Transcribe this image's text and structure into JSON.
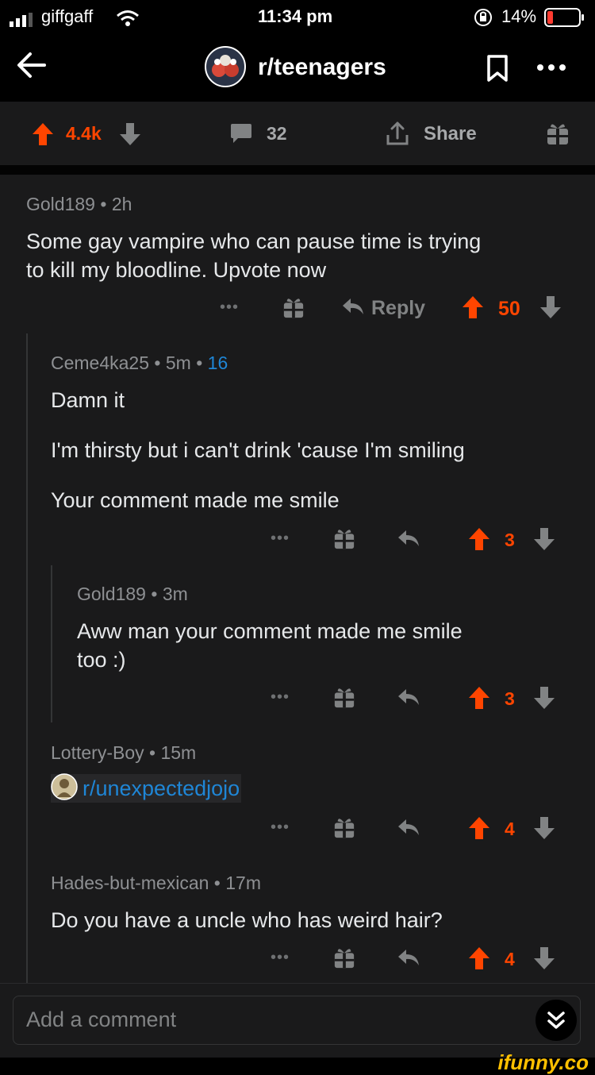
{
  "status_bar": {
    "carrier": "giffgaff",
    "time": "11:34 pm",
    "battery": "14%"
  },
  "header": {
    "subreddit": "r/teenagers"
  },
  "action_bar": {
    "votes": "4.4k",
    "comments": "32",
    "share": "Share"
  },
  "comments": [
    {
      "author": "Gold189",
      "age": "2h",
      "text_lines": [
        "Some gay vampire who can pause time is trying",
        "to kill my bloodline. Upvote now"
      ],
      "reply": "Reply",
      "score": "50"
    },
    {
      "author": "Ceme4ka25",
      "age": "5m",
      "extra": "16",
      "text_lines": [
        "Damn it",
        "I'm thirsty but i can't drink 'cause I'm smiling",
        "Your comment made me smile"
      ],
      "score": "3"
    },
    {
      "author": "Gold189",
      "age": "3m",
      "text_lines": [
        "Aww man your comment made me smile",
        "too :)"
      ],
      "score": "3"
    },
    {
      "author": "Lottery-Boy",
      "age": "15m",
      "link": "r/unexpectedjojo",
      "score": "4"
    },
    {
      "author": "Hades-but-mexican",
      "age": "17m",
      "text_lines": [
        "Do you have a uncle who has weird hair?"
      ],
      "score": "4"
    }
  ],
  "composer": {
    "placeholder": "Add a comment"
  },
  "watermark": "ifunny.co",
  "colors": {
    "upvote": "#ff4500",
    "background": "#1a1a1b",
    "link": "#1f86d6"
  }
}
